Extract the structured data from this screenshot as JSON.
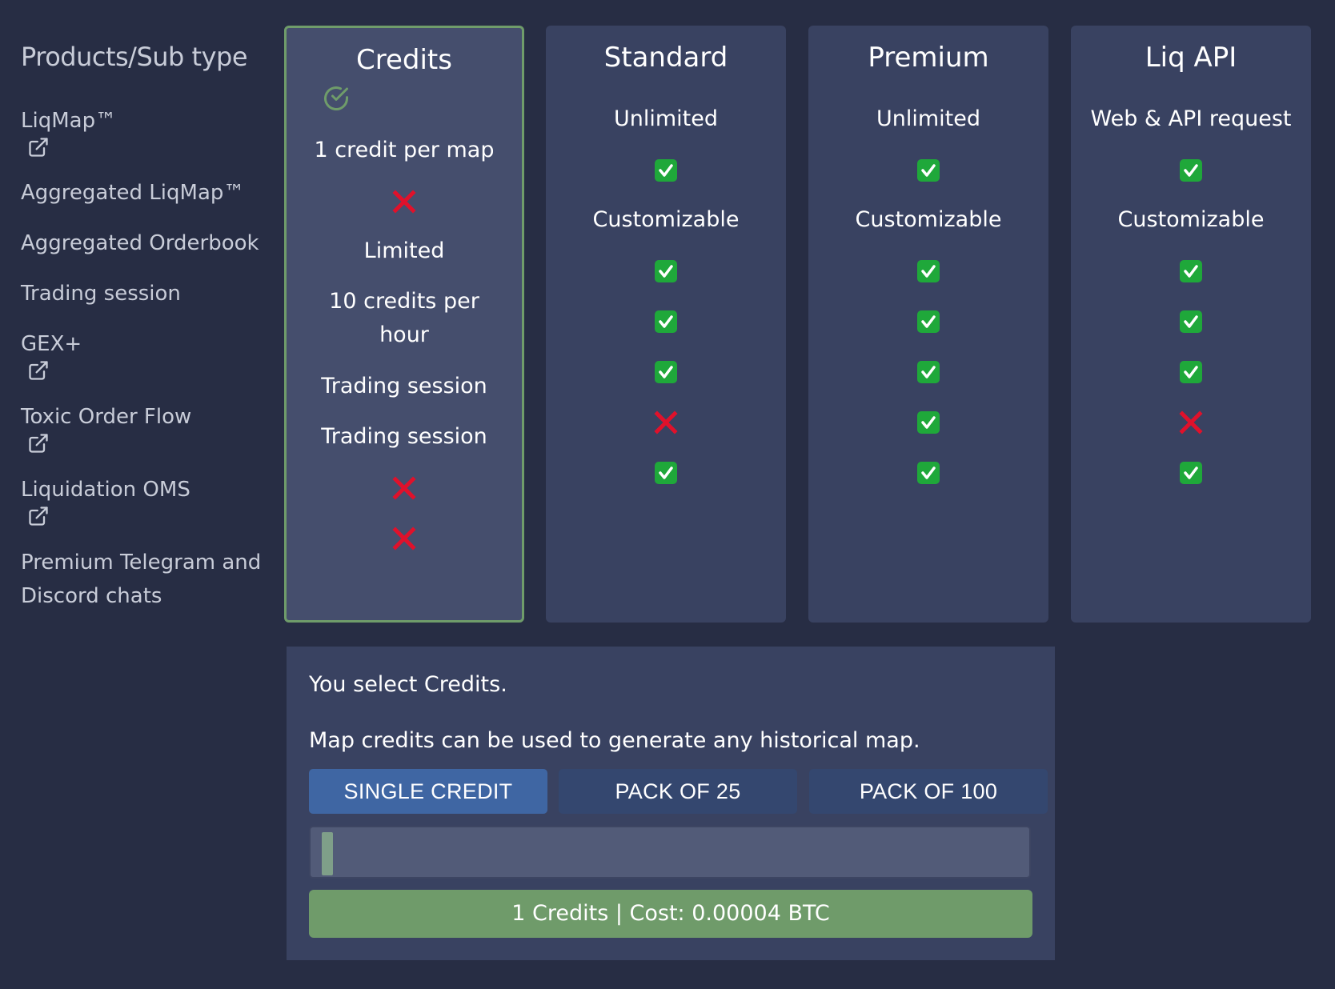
{
  "products": {
    "title": "Products/Sub type",
    "items": [
      {
        "label": "LiqMap™",
        "external_link": true
      },
      {
        "label": "Aggregated LiqMap™",
        "external_link": false
      },
      {
        "label": "Aggregated Orderbook",
        "external_link": false
      },
      {
        "label": "Trading session",
        "external_link": false
      },
      {
        "label": "GEX+",
        "external_link": true
      },
      {
        "label": "Toxic Order Flow",
        "external_link": true
      },
      {
        "label": "Liquidation OMS",
        "external_link": true
      },
      {
        "label_line1": "Premium Telegram and",
        "label_line2": "Discord chats",
        "external_link": false
      }
    ]
  },
  "plans": [
    {
      "name": "Credits",
      "selected": true,
      "rows": [
        "1 credit per map",
        "cross",
        "Limited",
        "10 credits per hour",
        "Trading session",
        "Trading session",
        "cross",
        "cross"
      ]
    },
    {
      "name": "Standard",
      "selected": false,
      "rows": [
        "Unlimited",
        "check",
        "Customizable",
        "check",
        "check",
        "check",
        "cross",
        "check"
      ]
    },
    {
      "name": "Premium",
      "selected": false,
      "rows": [
        "Unlimited",
        "check",
        "Customizable",
        "check",
        "check",
        "check",
        "check",
        "check"
      ]
    },
    {
      "name": "Liq API",
      "selected": false,
      "rows": [
        "Web & API request",
        "check",
        "Customizable",
        "check",
        "check",
        "check",
        "cross",
        "check"
      ]
    }
  ],
  "summary": {
    "selection_text": "You select Credits.",
    "description": "Map credits can be used to generate any historical map.",
    "pack_options": [
      "SINGLE CREDIT",
      "PACK OF 25",
      "PACK OF 100"
    ],
    "active_pack": "SINGLE CREDIT",
    "slider_fraction": 0.0,
    "buy_label": "1 Credits | Cost: 0.00004 BTC"
  },
  "colors": {
    "background": "#272d44",
    "card": "#394261",
    "card_selected": "#454e6d",
    "selected_border": "#6f9c6a",
    "check_green": "#1fa83a",
    "cross_red": "#e0112b",
    "button_active": "#3f66a3",
    "button": "#34476f",
    "buy_green": "#6f9b6a"
  },
  "icons": {
    "external": "external-link-icon",
    "check": "check-mark-icon",
    "cross": "cross-mark-icon",
    "selected": "selected-check-circle-icon"
  }
}
